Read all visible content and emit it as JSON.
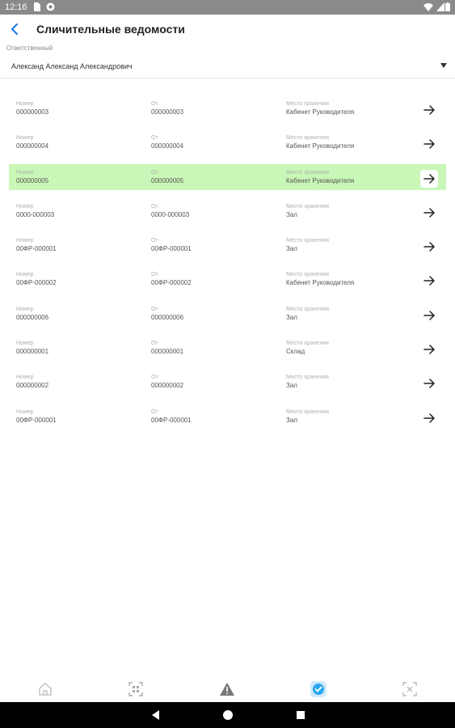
{
  "statusbar": {
    "time": "12:16"
  },
  "appbar": {
    "title": "Сличительные ведомости"
  },
  "responsible": {
    "label": "Ответственный",
    "value": "Александ Александ Александрович"
  },
  "columns": {
    "number": "Номер",
    "from": "От",
    "storage": "Место хранения"
  },
  "rows": [
    {
      "number": "000000003",
      "from": "000000003",
      "storage": "Кабенет Руководителя"
    },
    {
      "number": "000000004",
      "from": "000000004",
      "storage": "Кабенет Руководителя"
    },
    {
      "number": "000000005",
      "from": "000000005",
      "storage": "Кабенет Руководителя"
    },
    {
      "number": "0000-000003",
      "from": "0000-000003",
      "storage": "Зал"
    },
    {
      "number": "00ФР-000001",
      "from": "00ФР-000001",
      "storage": "Зал"
    },
    {
      "number": "00ФР-000002",
      "from": "00ФР-000002",
      "storage": "Кабенет Руководителя"
    },
    {
      "number": "000000006",
      "from": "000000006",
      "storage": "Зал"
    },
    {
      "number": "000000001",
      "from": "000000001",
      "storage": "Склад"
    },
    {
      "number": "000000002",
      "from": "000000002",
      "storage": "Зал"
    },
    {
      "number": "00ФР-000001",
      "from": "00ФР-000001",
      "storage": "Зал"
    }
  ],
  "selected_row": 3,
  "colors": {
    "selected_row": "#c9f7b7",
    "accent": "#1a73e8",
    "nav_active": "#2aa8f0"
  },
  "bottom_nav": {
    "items": [
      "home-icon",
      "qr-scan-icon",
      "warning-icon",
      "check-circle-icon",
      "scan-cancel-icon"
    ],
    "active": "check-circle-icon"
  }
}
